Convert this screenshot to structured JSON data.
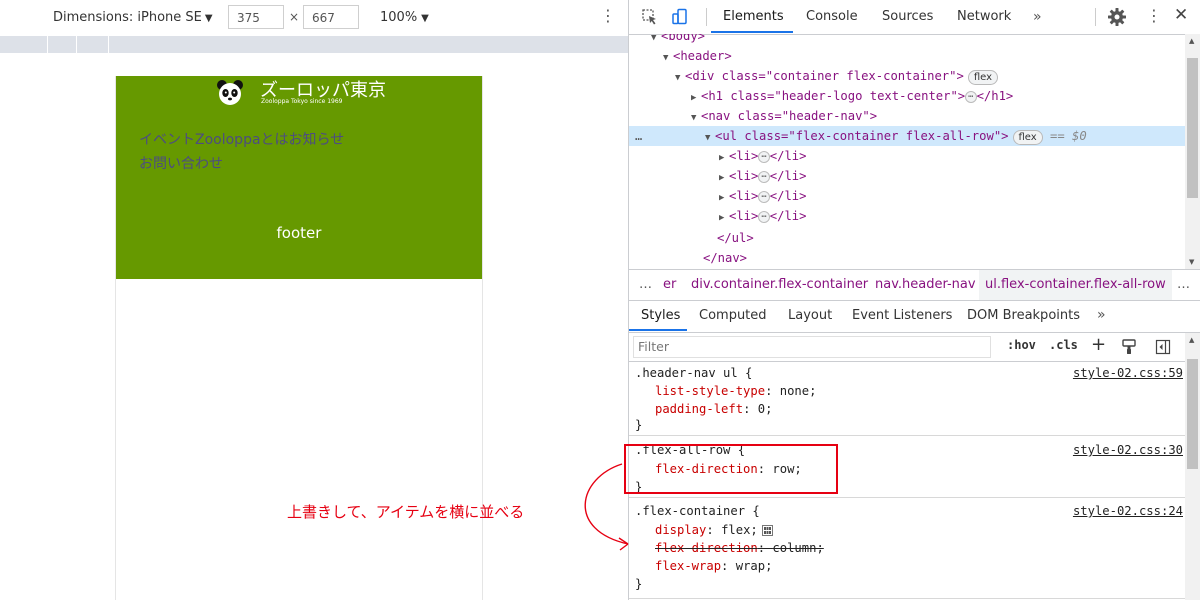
{
  "device_toolbar": {
    "dimensions_label": "Dimensions: iPhone SE",
    "width": "375",
    "times": "×",
    "height": "667",
    "zoom": "100%"
  },
  "site": {
    "logo_title": "ズーロッパ東京",
    "logo_subtitle": "Zooloppa Tokyo since 1969",
    "nav_items": [
      "イベント",
      "Zooloppaとは",
      "お知らせ",
      "お問い合わせ"
    ],
    "footer": "footer",
    "header_color": "#669900"
  },
  "devtools": {
    "tabs": [
      "Elements",
      "Console",
      "Sources",
      "Network",
      "»"
    ],
    "dom": [
      "<body>",
      "<header>",
      "<div class=\"container flex-container\">",
      "flex",
      "<h1 class=\"header-logo text-center\">",
      "</h1>",
      "<nav class=\"header-nav\">",
      "<ul class=\"flex-container flex-all-row\">",
      "flex",
      "== $0",
      "<li>",
      "</li>",
      "</ul>",
      "</nav>"
    ],
    "ellipsis": "…",
    "breadcrumbs": [
      "…",
      "er",
      "div.container.flex-container",
      "nav.header-nav",
      "ul.flex-container.flex-all-row",
      "…"
    ],
    "style_tabs": [
      "Styles",
      "Computed",
      "Layout",
      "Event Listeners",
      "DOM Breakpoints",
      "»"
    ],
    "filter_placeholder": "Filter",
    "hov": ":hov",
    "cls": ".cls",
    "plus": "+",
    "rules": [
      {
        "selector": ".header-nav ul {",
        "source": "style-02.css:59",
        "decls": [
          {
            "prop": "list-style-type",
            "value": "none;"
          },
          {
            "prop": "padding-left",
            "value": "0;"
          }
        ],
        "close": "}"
      },
      {
        "selector": ".flex-all-row {",
        "source": "style-02.css:30",
        "decls": [
          {
            "prop": "flex-direction",
            "value": "row;"
          }
        ],
        "close": "}"
      },
      {
        "selector": ".flex-container {",
        "source": "style-02.css:24",
        "decls": [
          {
            "prop": "display",
            "value": "flex;"
          },
          {
            "prop": "flex-direction",
            "value": "column;"
          },
          {
            "prop": "flex-wrap",
            "value": "wrap;"
          }
        ],
        "close": "}"
      }
    ]
  },
  "annotation": {
    "text": "上書きして、アイテムを横に並べる",
    "color": "#e60012"
  }
}
